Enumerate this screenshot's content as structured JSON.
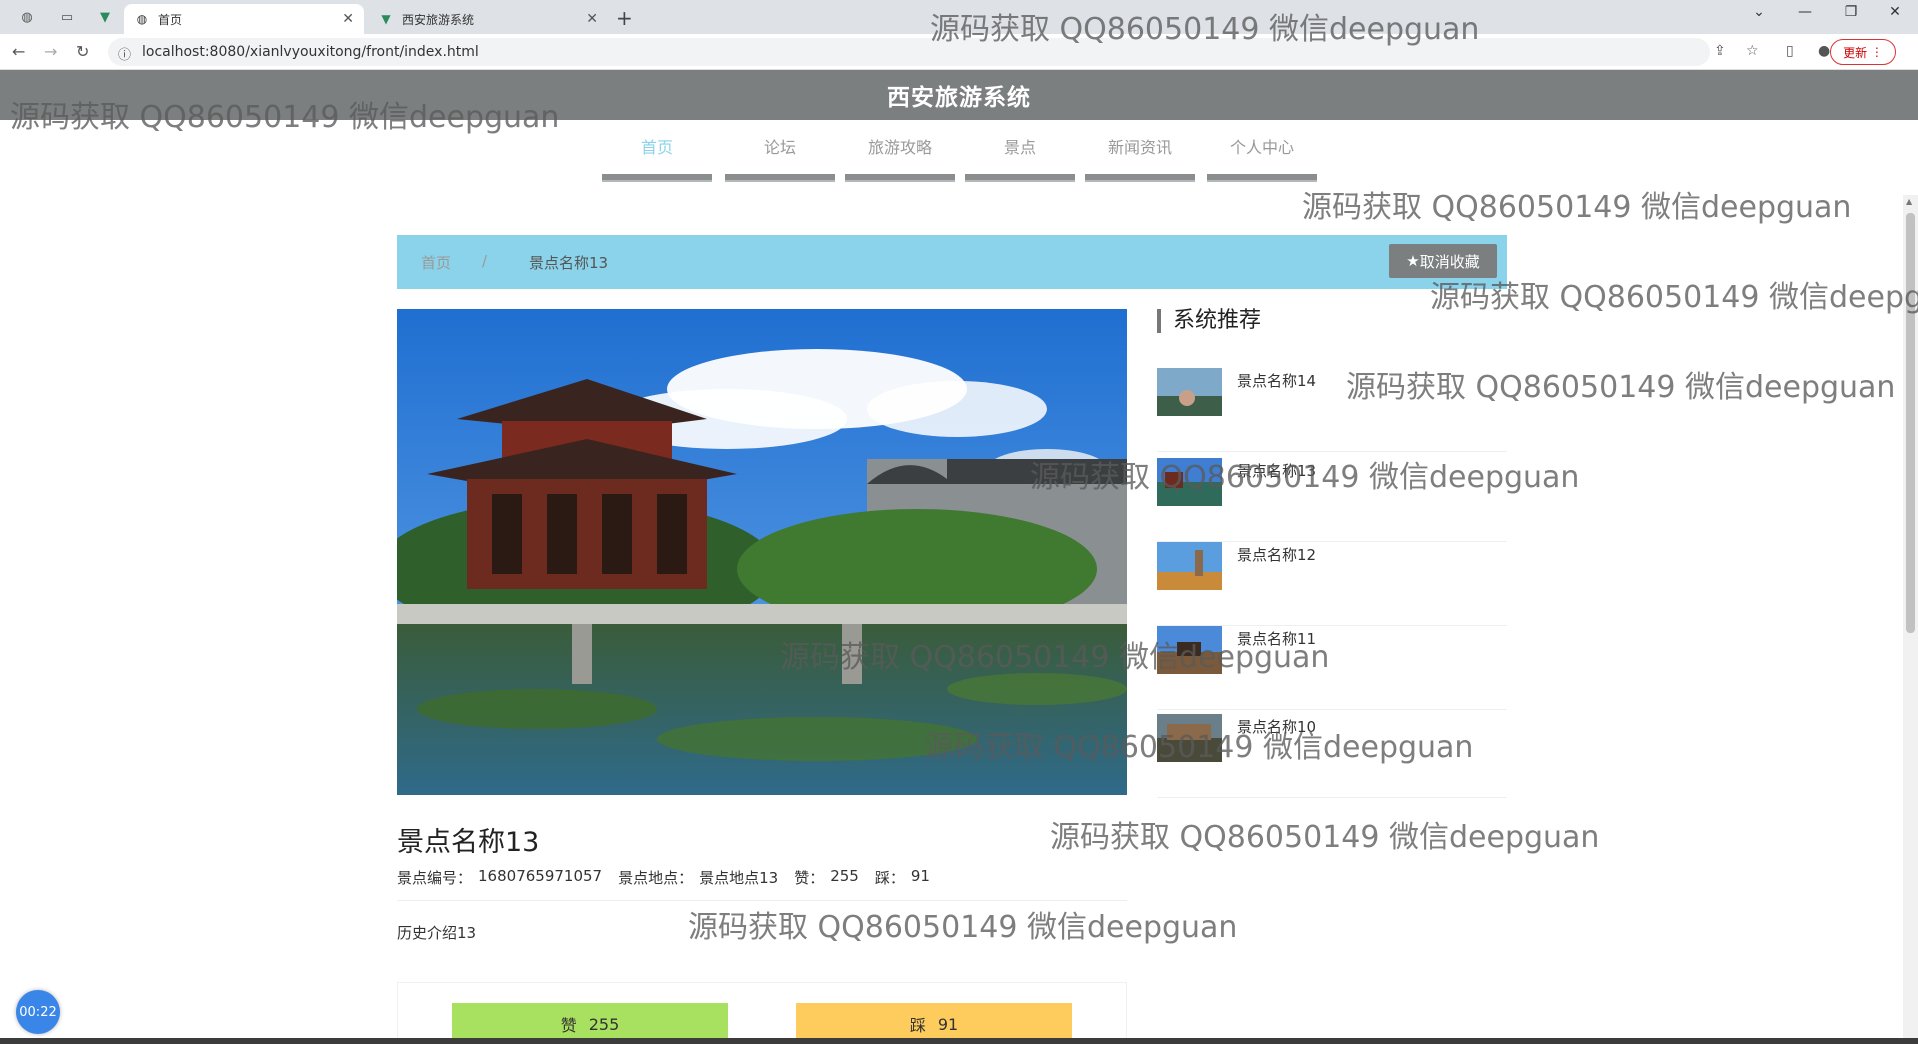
{
  "browser": {
    "tabs": [
      {
        "title": "首页",
        "active": true
      },
      {
        "title": "西安旅游系统",
        "active": false
      }
    ],
    "url": "localhost:8080/xianlvyouxitong/front/index.html",
    "update_label": "更新"
  },
  "site": {
    "title": "西安旅游系统",
    "nav": [
      "首页",
      "论坛",
      "旅游攻略",
      "景点",
      "新闻资讯",
      "个人中心"
    ],
    "active_nav": "首页"
  },
  "breadcrumb": {
    "home": "首页",
    "separator": "/",
    "current": "景点名称13",
    "unfavorite_label": "取消收藏"
  },
  "detail": {
    "title": "景点名称13",
    "meta": [
      {
        "label": "景点编号：",
        "value": "1680765971057"
      },
      {
        "label": "景点地点：",
        "value": "景点地点13"
      },
      {
        "label": "赞：",
        "value": "255"
      },
      {
        "label": "踩：",
        "value": "91"
      }
    ],
    "intro": "历史介绍13",
    "like_label": "赞",
    "like_count": "255",
    "dislike_label": "踩",
    "dislike_count": "91"
  },
  "sidebar": {
    "title": "系统推荐",
    "items": [
      "景点名称14",
      "景点名称13",
      "景点名称12",
      "景点名称11",
      "景点名称10"
    ]
  },
  "timer": "00:22",
  "watermark": "源码获取 QQ86050149 微信deepguan",
  "colors": {
    "header_bg": "#7b7f80",
    "accent": "#8bd3ea",
    "like": "#a8e05f",
    "dislike": "#fdcc5c"
  }
}
